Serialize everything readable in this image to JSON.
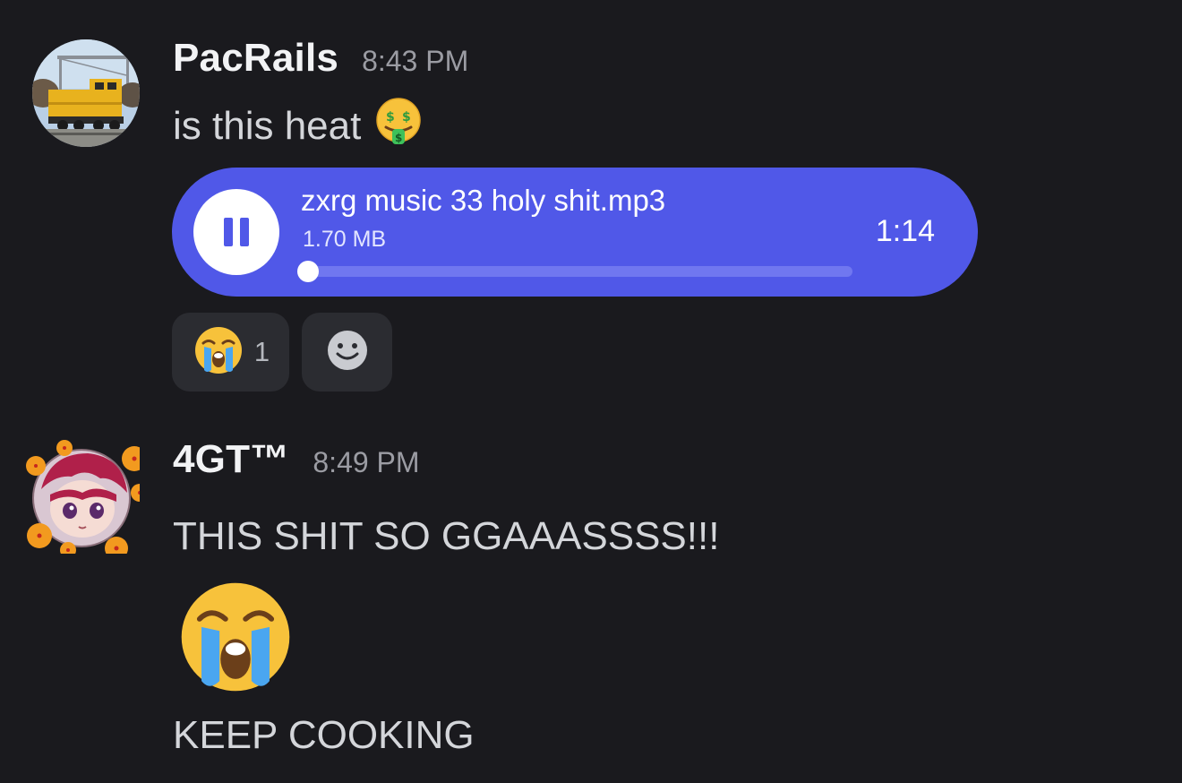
{
  "messages": [
    {
      "username": "PacRails",
      "timestamp": "8:43 PM",
      "text": "is this heat",
      "text_emoji": "money-mouth-face",
      "attachment": {
        "file_name": "zxrg music 33 holy shit.mp3",
        "file_size": "1.70 MB",
        "duration": "1:14",
        "state_icon": "pause-icon",
        "progress": 0
      },
      "reactions": [
        {
          "emoji": "loudly-crying-face",
          "count": "1"
        },
        {
          "emoji": "add-reaction-smiley-icon"
        }
      ]
    },
    {
      "username": "4GT™",
      "timestamp": "8:49 PM",
      "lines": [
        "THIS SHIT SO GGAAASSSS!!!",
        "KEEP COOKING"
      ],
      "big_emoji": "loudly-crying-face"
    }
  ],
  "colors": {
    "background": "#1a1a1e",
    "audio_player": "#5058e8",
    "reaction_pill": "#2b2c31",
    "timestamp": "#9b9ca3"
  }
}
